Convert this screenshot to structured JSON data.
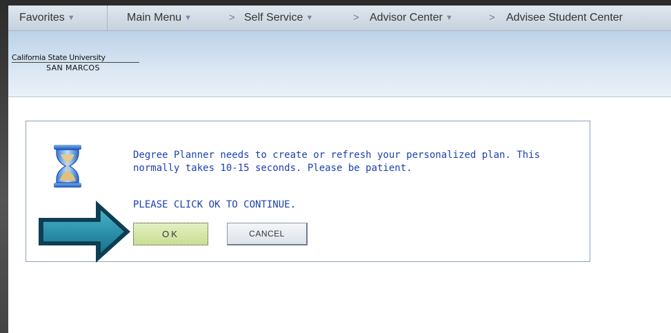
{
  "navbar": {
    "favorites": "Favorites",
    "main_menu": "Main Menu",
    "self_service": "Self Service",
    "advisor_center": "Advisor Center",
    "advisee_student_center": "Advisee Student Center",
    "separator": ">"
  },
  "header": {
    "logo_line1": "California State University",
    "logo_line2": "SAN MARCOS"
  },
  "dialog": {
    "icon": "hourglass-icon",
    "message": "Degree Planner needs to create or refresh your personalized plan. This normally takes 10-15 seconds. Please be patient.",
    "prompt": "PLEASE CLICK OK TO CONTINUE.",
    "ok_label": "OK",
    "cancel_label": "CANCEL"
  },
  "annotation": {
    "arrow": "arrow-right-icon",
    "color": "#1f8aa6"
  },
  "colors": {
    "message_text": "#1c3fb0",
    "ok_button": "#d4e6a6",
    "header_gradient": "#c8dbee"
  }
}
